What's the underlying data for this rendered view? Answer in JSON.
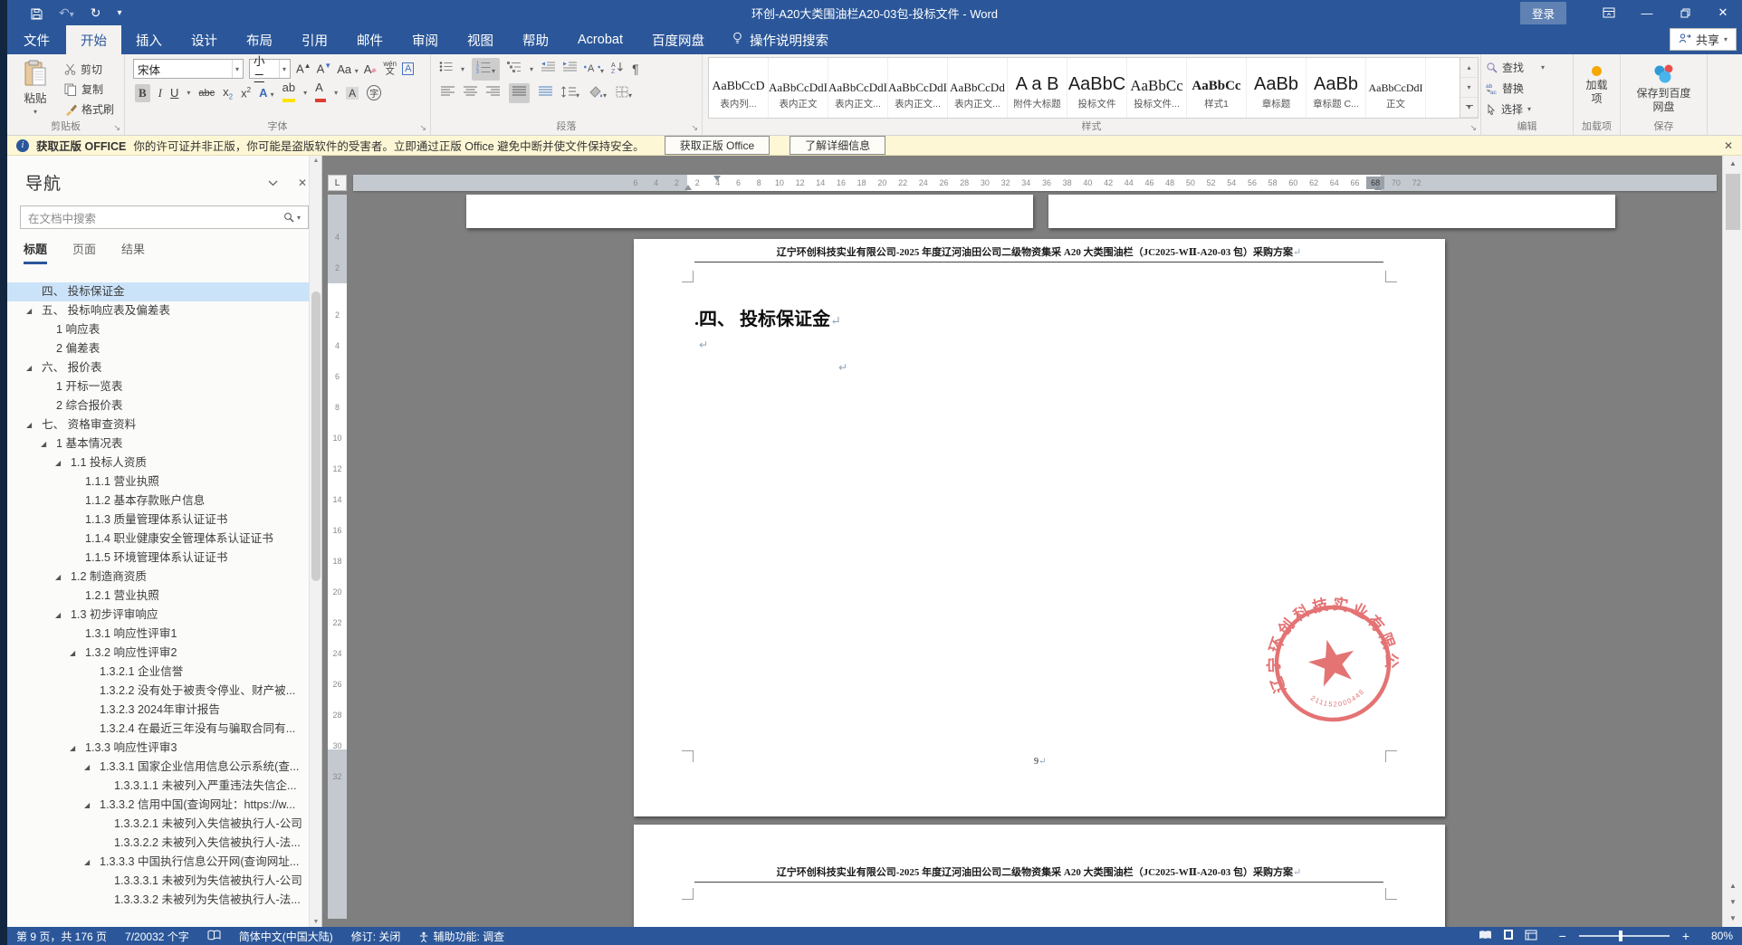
{
  "colors": {
    "accent": "#2b579a",
    "ribbon_bg": "#f3f2f1",
    "doc_bg": "#7f7f7f",
    "notice_bg": "#fdf7d5",
    "seal": "#df5a5c",
    "highlight_yellow": "#ffe400",
    "font_red": "#e03c31",
    "nav_selected": "#cbe3f9"
  },
  "window": {
    "title": "环创-A20大类围油栏A20-03包-投标文件  -  Word",
    "signin": "登录",
    "share": "共享"
  },
  "tabs": {
    "file": "文件",
    "items": [
      "开始",
      "插入",
      "设计",
      "布局",
      "引用",
      "邮件",
      "审阅",
      "视图",
      "帮助",
      "Acrobat",
      "百度网盘"
    ],
    "active": "开始",
    "tell_me": "操作说明搜索"
  },
  "icons": {
    "cut_glyph": "",
    "bold": "B",
    "italic": "I",
    "underline": "U",
    "strikethrough": "abc",
    "subscript": "x",
    "superscript": "x",
    "grow_font": "A",
    "shrink_font": "A",
    "change_case": "Aa",
    "clear_format": "A",
    "phonetic_top": "wén",
    "phonetic_bottom": "文",
    "char_border": "A",
    "text_effects": "A",
    "highlight": "ab",
    "font_color": "A",
    "char_shading": "A",
    "enclose": "字",
    "pilcrow_toggle": "¶",
    "up": "▴",
    "down": "▾",
    "left_tab": "L",
    "chevron": "ᐯ",
    "close": "✕",
    "min": "—"
  },
  "ribbon": {
    "clipboard": {
      "group_label": "剪贴板",
      "paste": "粘贴",
      "cut": "剪切",
      "copy": "复制",
      "format_painter": "格式刷"
    },
    "font": {
      "group_label": "字体",
      "font_name": "宋体",
      "font_size": "小二"
    },
    "paragraph": {
      "group_label": "段落"
    },
    "styles": {
      "group_label": "样式",
      "items": [
        {
          "preview": "AaBbCcD",
          "label": "表内列..."
        },
        {
          "preview": "AaBbCcDdI",
          "label": "表内正文"
        },
        {
          "preview": "AaBbCcDdI",
          "label": "表内正文..."
        },
        {
          "preview": "AaBbCcDdI",
          "label": "表内正文..."
        },
        {
          "preview": "AaBbCcDd",
          "label": "表内正文..."
        },
        {
          "preview": "A a B",
          "label": "附件大标题"
        },
        {
          "preview": "AaBbC",
          "label": "投标文件"
        },
        {
          "preview": "AaBbCc",
          "label": "投标文件..."
        },
        {
          "preview": "AaBbCc",
          "label": "样式1"
        },
        {
          "preview": "AaBb",
          "label": "章标题"
        },
        {
          "preview": "AaBb",
          "label": "章标题 C..."
        },
        {
          "preview": "AaBbCcDdI",
          "label": "正文"
        }
      ]
    },
    "editing": {
      "group_label": "编辑",
      "find": "查找",
      "replace": "替换",
      "select": "选择"
    },
    "addins": {
      "group_label": "加载项",
      "button": "加载项"
    },
    "baidu": {
      "group_label": "保存",
      "button": "保存到百度网盘"
    }
  },
  "notice": {
    "title": "获取正版 OFFICE",
    "message": "你的许可证并非正版，你可能是盗版软件的受害者。立即通过正版 Office 避免中断并使文件保持安全。",
    "button_activate": "获取正版 Office",
    "button_learn": "了解详细信息"
  },
  "nav": {
    "title": "导航",
    "search_placeholder": "在文档中搜索",
    "tabs": [
      "标题",
      "页面",
      "结果"
    ],
    "active_tab": "标题",
    "items": [
      {
        "text": "四、 投标保证金",
        "level": 0,
        "arrow": false,
        "selected": true
      },
      {
        "text": "五、 投标响应表及偏差表",
        "level": 0,
        "arrow": true,
        "selected": false
      },
      {
        "text": "1 响应表",
        "level": 1,
        "arrow": false,
        "selected": false
      },
      {
        "text": "2 偏差表",
        "level": 1,
        "arrow": false,
        "selected": false
      },
      {
        "text": "六、 报价表",
        "level": 0,
        "arrow": true,
        "selected": false
      },
      {
        "text": "1 开标一览表",
        "level": 1,
        "arrow": false,
        "selected": false
      },
      {
        "text": "2 综合报价表",
        "level": 1,
        "arrow": false,
        "selected": false
      },
      {
        "text": "七、 资格审查资料",
        "level": 0,
        "arrow": true,
        "selected": false
      },
      {
        "text": "1 基本情况表",
        "level": 1,
        "arrow": true,
        "selected": false
      },
      {
        "text": "1.1 投标人资质",
        "level": 2,
        "arrow": true,
        "selected": false
      },
      {
        "text": "1.1.1 营业执照",
        "level": 3,
        "arrow": false,
        "selected": false
      },
      {
        "text": "1.1.2 基本存款账户信息",
        "level": 3,
        "arrow": false,
        "selected": false
      },
      {
        "text": "1.1.3 质量管理体系认证证书",
        "level": 3,
        "arrow": false,
        "selected": false
      },
      {
        "text": "1.1.4 职业健康安全管理体系认证证书",
        "level": 3,
        "arrow": false,
        "selected": false
      },
      {
        "text": "1.1.5 环境管理体系认证证书",
        "level": 3,
        "arrow": false,
        "selected": false
      },
      {
        "text": "1.2 制造商资质",
        "level": 2,
        "arrow": true,
        "selected": false
      },
      {
        "text": "1.2.1 营业执照",
        "level": 3,
        "arrow": false,
        "selected": false
      },
      {
        "text": "1.3 初步评审响应",
        "level": 2,
        "arrow": true,
        "selected": false
      },
      {
        "text": "1.3.1 响应性评审1",
        "level": 3,
        "arrow": false,
        "selected": false
      },
      {
        "text": "1.3.2 响应性评审2",
        "level": 3,
        "arrow": true,
        "selected": false
      },
      {
        "text": "1.3.2.1 企业信誉",
        "level": 4,
        "arrow": false,
        "selected": false
      },
      {
        "text": "1.3.2.2 没有处于被责令停业、财产被...",
        "level": 4,
        "arrow": false,
        "selected": false
      },
      {
        "text": "1.3.2.3 2024年审计报告",
        "level": 4,
        "arrow": false,
        "selected": false
      },
      {
        "text": "1.3.2.4 在最近三年没有与骗取合同有...",
        "level": 4,
        "arrow": false,
        "selected": false
      },
      {
        "text": "1.3.3 响应性评审3",
        "level": 3,
        "arrow": true,
        "selected": false
      },
      {
        "text": "1.3.3.1 国家企业信用信息公示系统(查...",
        "level": 4,
        "arrow": true,
        "selected": false
      },
      {
        "text": "1.3.3.1.1 未被列入严重违法失信企...",
        "level": 5,
        "arrow": false,
        "selected": false
      },
      {
        "text": "1.3.3.2 信用中国(查询网址：https://w...",
        "level": 4,
        "arrow": true,
        "selected": false
      },
      {
        "text": "1.3.3.2.1 未被列入失信被执行人-公司",
        "level": 5,
        "arrow": false,
        "selected": false
      },
      {
        "text": "1.3.3.2.2 未被列入失信被执行人-法...",
        "level": 5,
        "arrow": false,
        "selected": false
      },
      {
        "text": "1.3.3.3 中国执行信息公开网(查询网址...",
        "level": 4,
        "arrow": true,
        "selected": false
      },
      {
        "text": "1.3.3.3.1 未被列为失信被执行人-公司",
        "level": 5,
        "arrow": false,
        "selected": false
      },
      {
        "text": "1.3.3.3.2 未被列为失信被执行人-法...",
        "level": 5,
        "arrow": false,
        "selected": false
      }
    ]
  },
  "document": {
    "header_line": "辽宁环创科技实业有限公司-2025 年度辽河油田公司二级物资集采 A20 大类围油栏（JC2025-WⅡ-A20-03 包）采购方案",
    "heading": ".四、 投标保证金",
    "pilcrow": "↵",
    "page_number": "9",
    "seal": {
      "company": "辽宁环创科技实业有限公司",
      "serial": "211152000448"
    },
    "h_ruler": [
      "6",
      "4",
      "2",
      "2",
      "4",
      "6",
      "8",
      "10",
      "12",
      "14",
      "16",
      "18",
      "20",
      "22",
      "24",
      "26",
      "28",
      "30",
      "32",
      "34",
      "36",
      "38",
      "40",
      "42",
      "44",
      "46",
      "48",
      "50",
      "52",
      "54",
      "56",
      "58",
      "60",
      "62",
      "64",
      "66",
      "68",
      "70",
      "72"
    ],
    "v_ruler": [
      "4",
      "2",
      "2",
      "4",
      "6",
      "8",
      "10",
      "12",
      "14",
      "16",
      "18",
      "20",
      "22",
      "24",
      "26",
      "28",
      "30",
      "32"
    ]
  },
  "status": {
    "page_info": "第 9 页，共 176 页",
    "words": "7/20032 个字",
    "language": "简体中文(中国大陆)",
    "track": "修订: 关闭",
    "accessibility": "辅助功能: 调查",
    "zoom": "80%"
  }
}
